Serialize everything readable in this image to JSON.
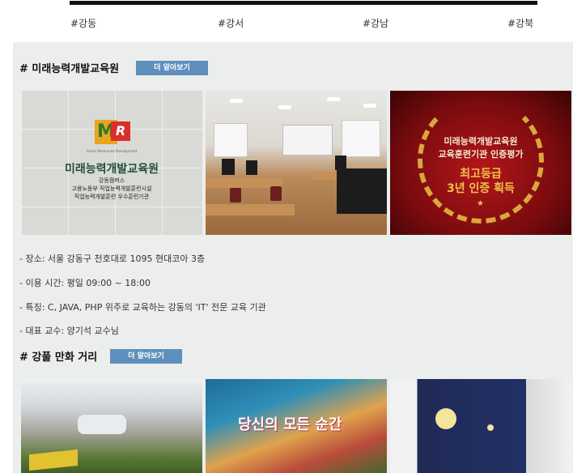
{
  "regions": [
    "#강동",
    "#강서",
    "#강남",
    "#강북"
  ],
  "section1": {
    "title": "# 미래능력개발교육원",
    "more_label": "더 알아보기",
    "photos": {
      "sign": {
        "logo_m": "M",
        "logo_r": "R",
        "logo_sub": "Future Resources Development",
        "name": "미래능력개발교육원",
        "campus": "강동캠퍼스",
        "line1": "고용노동부 직업능력개발훈련시설",
        "line2": "직업능력개발훈련 우수훈련기관"
      },
      "award": {
        "line1": "미래능력개발교육원",
        "line2": "교육훈련기관 인증평가",
        "line3": "최고등급",
        "line4": "3년 인증 획득"
      }
    },
    "info": [
      "- 장소: 서울 강동구 천호대로 1095 현대코아 3층",
      "- 이용 시간: 평일 09:00 ~ 18:00",
      "- 특징: C, JAVA, PHP 위주로 교육하는 강동의 'IT' 전문 교육 기관",
      "- 대표 교수: 양기석 교수님"
    ]
  },
  "section2": {
    "title": "# 강풀 만화 거리",
    "more_label": "더 알아보기",
    "mural_text": "당신의 모든 순간"
  },
  "colors": {
    "button": "#5f8fbd",
    "panel": "#eceeed",
    "award_gold": "#f3c14a",
    "award_red": "#b4161b"
  }
}
